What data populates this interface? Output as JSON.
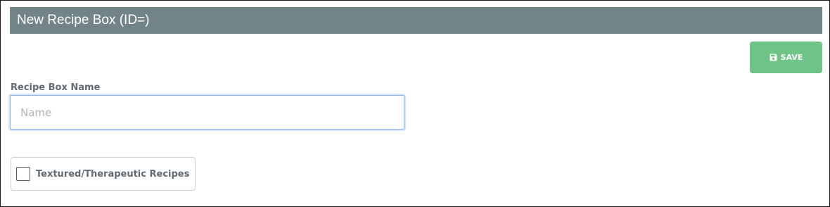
{
  "header": {
    "title": "New Recipe Box (ID=)"
  },
  "toolbar": {
    "save_label": "SAVE",
    "save_icon": "floppy-disk-icon"
  },
  "form": {
    "name_label": "Recipe Box Name",
    "name_value": "",
    "name_placeholder": "Name",
    "checkbox_label": "Textured/Therapeutic Recipes",
    "checkbox_checked": false
  },
  "colors": {
    "header_bg": "#738489",
    "save_bg": "#6ec486",
    "label_text": "#626c72",
    "input_focus_border": "#8db6e6"
  }
}
